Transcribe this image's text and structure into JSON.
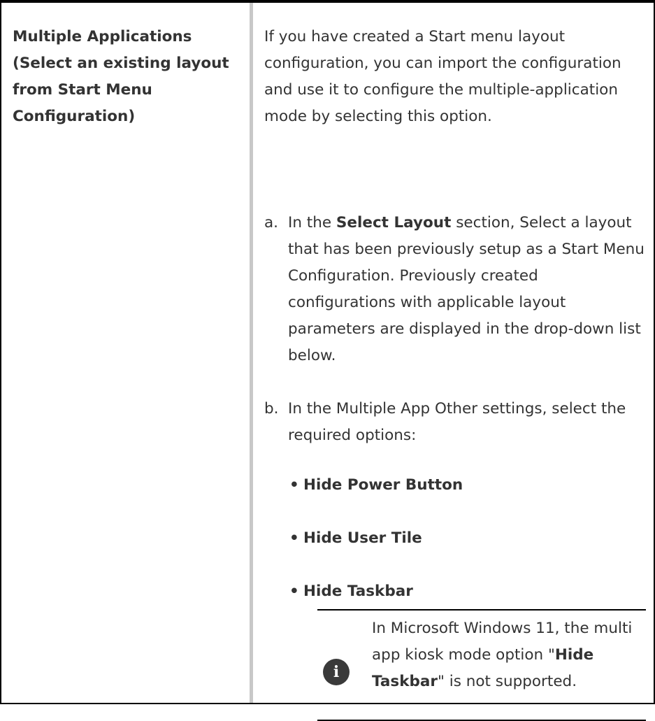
{
  "left_heading": "Multiple Applications (Select an existing layout from Start Menu Configuration)",
  "intro": "If you have created a Start menu layout configuration, you can import the configuration and use it to configure the multiple-application mode by selecting this option.",
  "steps": [
    {
      "marker": "a.",
      "prefix": "In the ",
      "bold": "Select Layout",
      "suffix": " section, Select a layout that has been previously setup as a Start Menu Configuration. Previously created configurations with applicable layout parameters are displayed in the drop-down list below."
    },
    {
      "marker": "b.",
      "text": "In the Multiple App Other settings, select the required options:"
    }
  ],
  "options": [
    "Hide Power Button",
    "Hide User Tile",
    "Hide Taskbar"
  ],
  "note": {
    "icon": "info-icon",
    "glyph": "i",
    "prefix": "In Microsoft Windows 11, the multi app kiosk mode option \"",
    "bold": "Hide Taskbar",
    "suffix": "\" is not supported."
  }
}
